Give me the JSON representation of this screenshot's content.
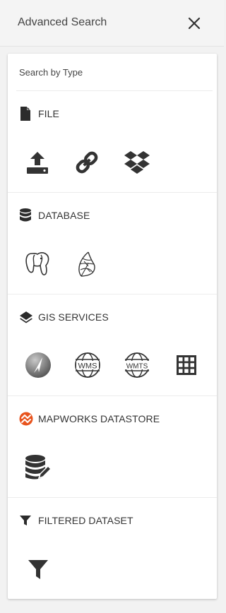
{
  "header": {
    "title": "Advanced Search"
  },
  "panel": {
    "search_label": "Search by Type",
    "sections": [
      {
        "title": "FILE",
        "options": [
          "upload-icon",
          "link-icon",
          "dropbox-icon"
        ]
      },
      {
        "title": "DATABASE",
        "options": [
          "postgresql-icon",
          "sql-server-icon"
        ]
      },
      {
        "title": "GIS SERVICES",
        "options": [
          "arcgis-icon",
          "wms-icon",
          "wmts-icon",
          "grid-table-icon"
        ]
      },
      {
        "title": "MAPWORKS DATASTORE",
        "options": [
          "datastore-edit-icon"
        ]
      },
      {
        "title": "FILTERED DATASET",
        "options": [
          "filter-icon"
        ]
      }
    ],
    "wms_text": "WMS",
    "wmts_text": "WMTS"
  },
  "colors": {
    "brand_orange": "#e8541e",
    "icon_dark": "#333333"
  }
}
